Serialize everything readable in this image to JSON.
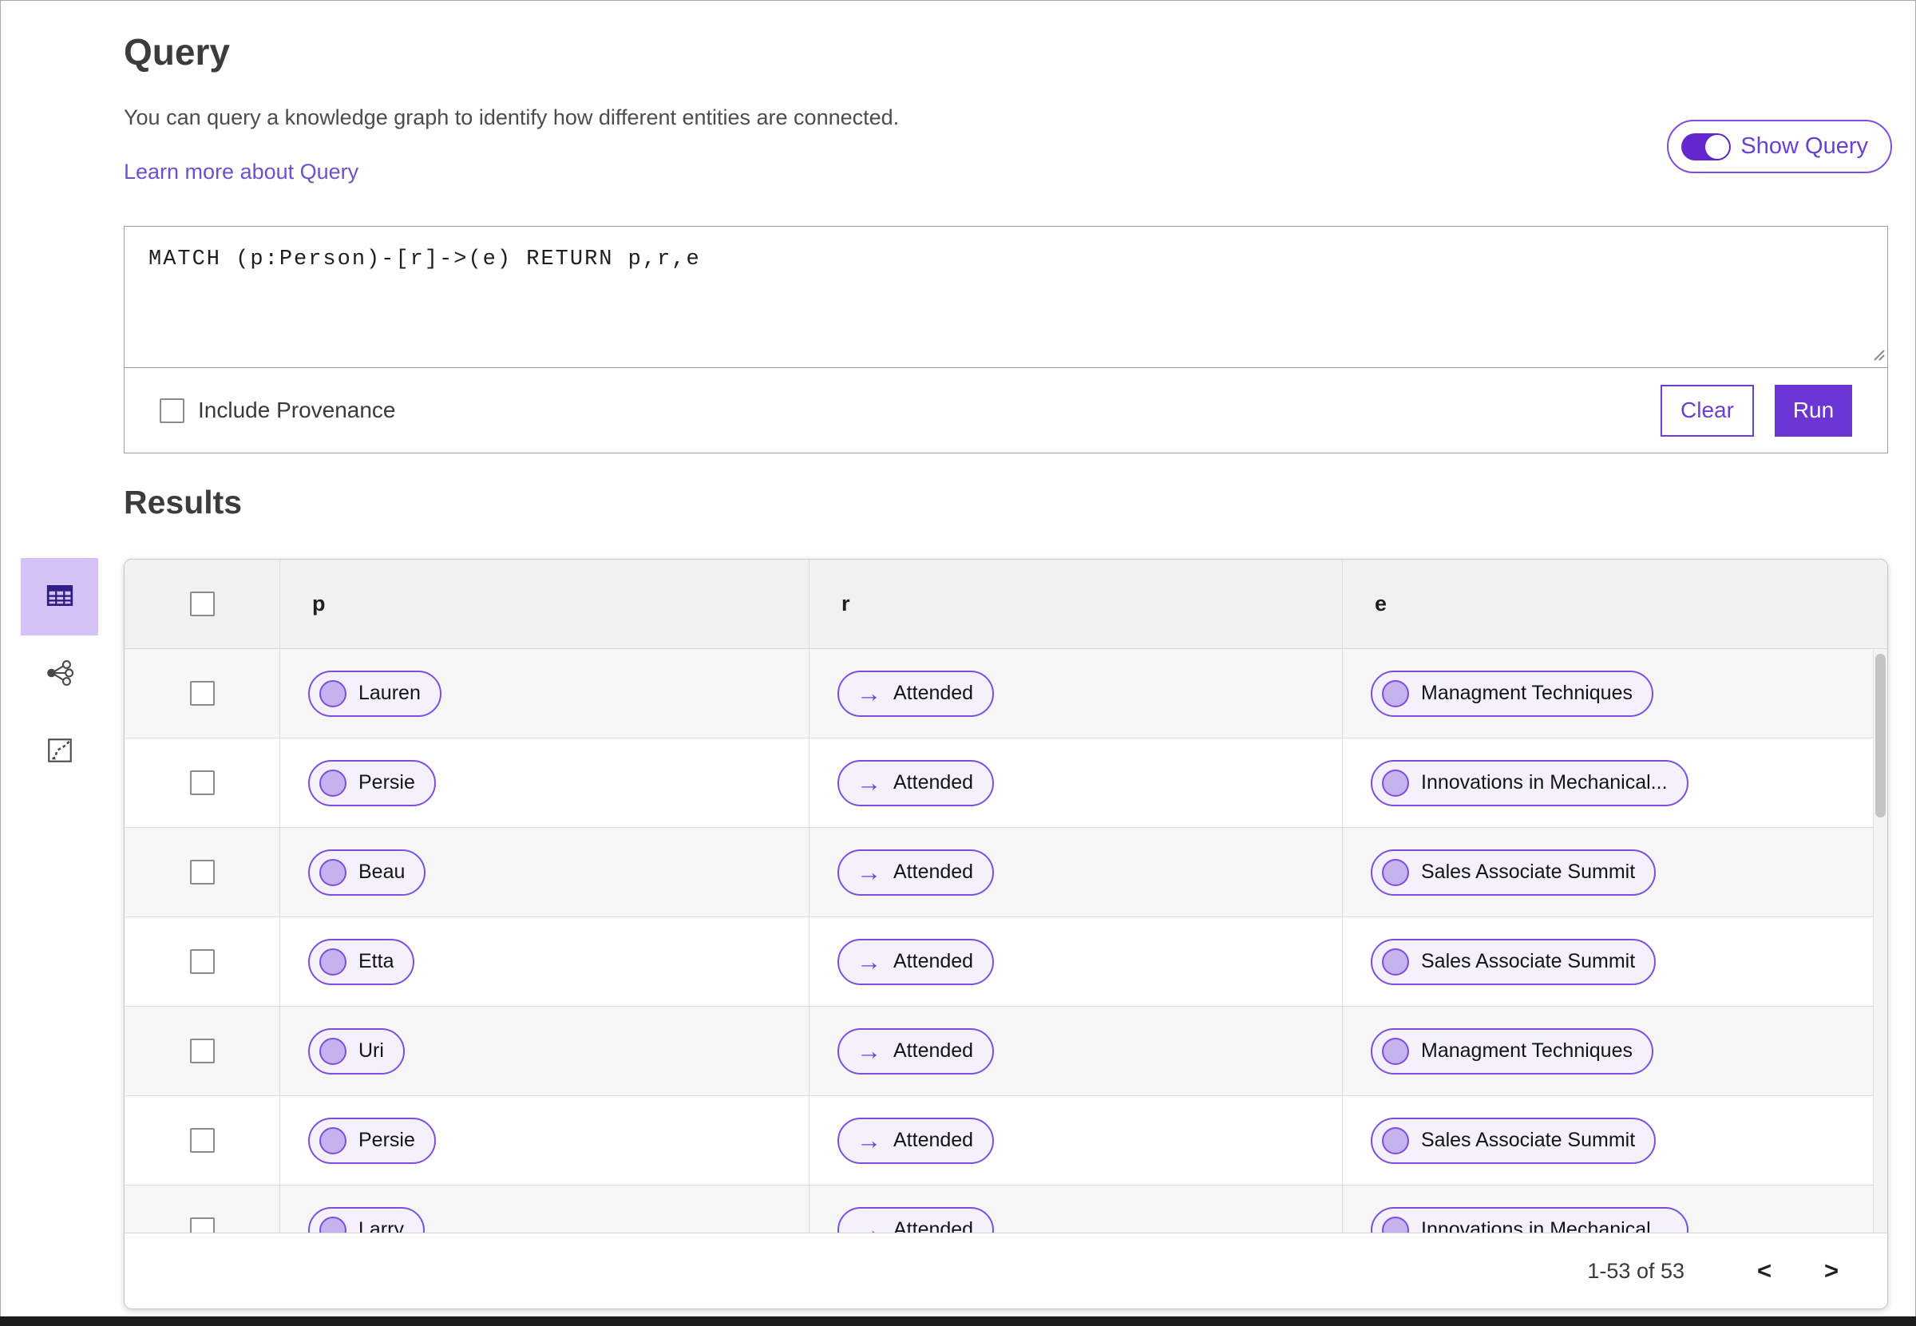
{
  "query_section": {
    "title": "Query",
    "description": "You can query a knowledge graph to identify how different entities are connected.",
    "learn_more_link": "Learn more about Query",
    "show_query_label": "Show Query",
    "show_query_on": true,
    "query_text": "MATCH (p:Person)-[r]->(e) RETURN p,r,e",
    "include_provenance_label": "Include Provenance",
    "include_provenance_checked": false,
    "clear_label": "Clear",
    "run_label": "Run"
  },
  "results_section": {
    "title": "Results",
    "view_buttons": [
      {
        "name": "table-view",
        "icon": "table-grid-icon",
        "selected": true
      },
      {
        "name": "graph-view",
        "icon": "share-network-icon",
        "selected": false
      },
      {
        "name": "map-view",
        "icon": "route-map-icon",
        "selected": false
      }
    ],
    "columns": [
      "p",
      "r",
      "e"
    ],
    "rows": [
      {
        "p": "Lauren",
        "r": "Attended",
        "e": "Managment Techniques"
      },
      {
        "p": "Persie",
        "r": "Attended",
        "e": "Innovations in Mechanical..."
      },
      {
        "p": "Beau",
        "r": "Attended",
        "e": "Sales Associate Summit"
      },
      {
        "p": "Etta",
        "r": "Attended",
        "e": "Sales Associate Summit"
      },
      {
        "p": "Uri",
        "r": "Attended",
        "e": "Managment Techniques"
      },
      {
        "p": "Persie",
        "r": "Attended",
        "e": "Sales Associate Summit"
      },
      {
        "p": "Larry",
        "r": "Attended",
        "e": "Innovations in Mechanical..."
      }
    ],
    "all_checkboxes_checked": false,
    "pagination": {
      "range_label": "1-53 of 53",
      "prev_glyph": "<",
      "next_glyph": ">"
    }
  },
  "colors": {
    "accent_purple": "#6a35d3",
    "pill_border": "#7c4fe0",
    "pill_background": "#f4f1fd",
    "node_circle_fill": "#c5b2ee",
    "selected_view_background": "#d5c3f8",
    "link_purple": "#6b51d2",
    "header_row_gray": "#f1f1f1",
    "alt_row_gray": "#f6f6f6"
  }
}
